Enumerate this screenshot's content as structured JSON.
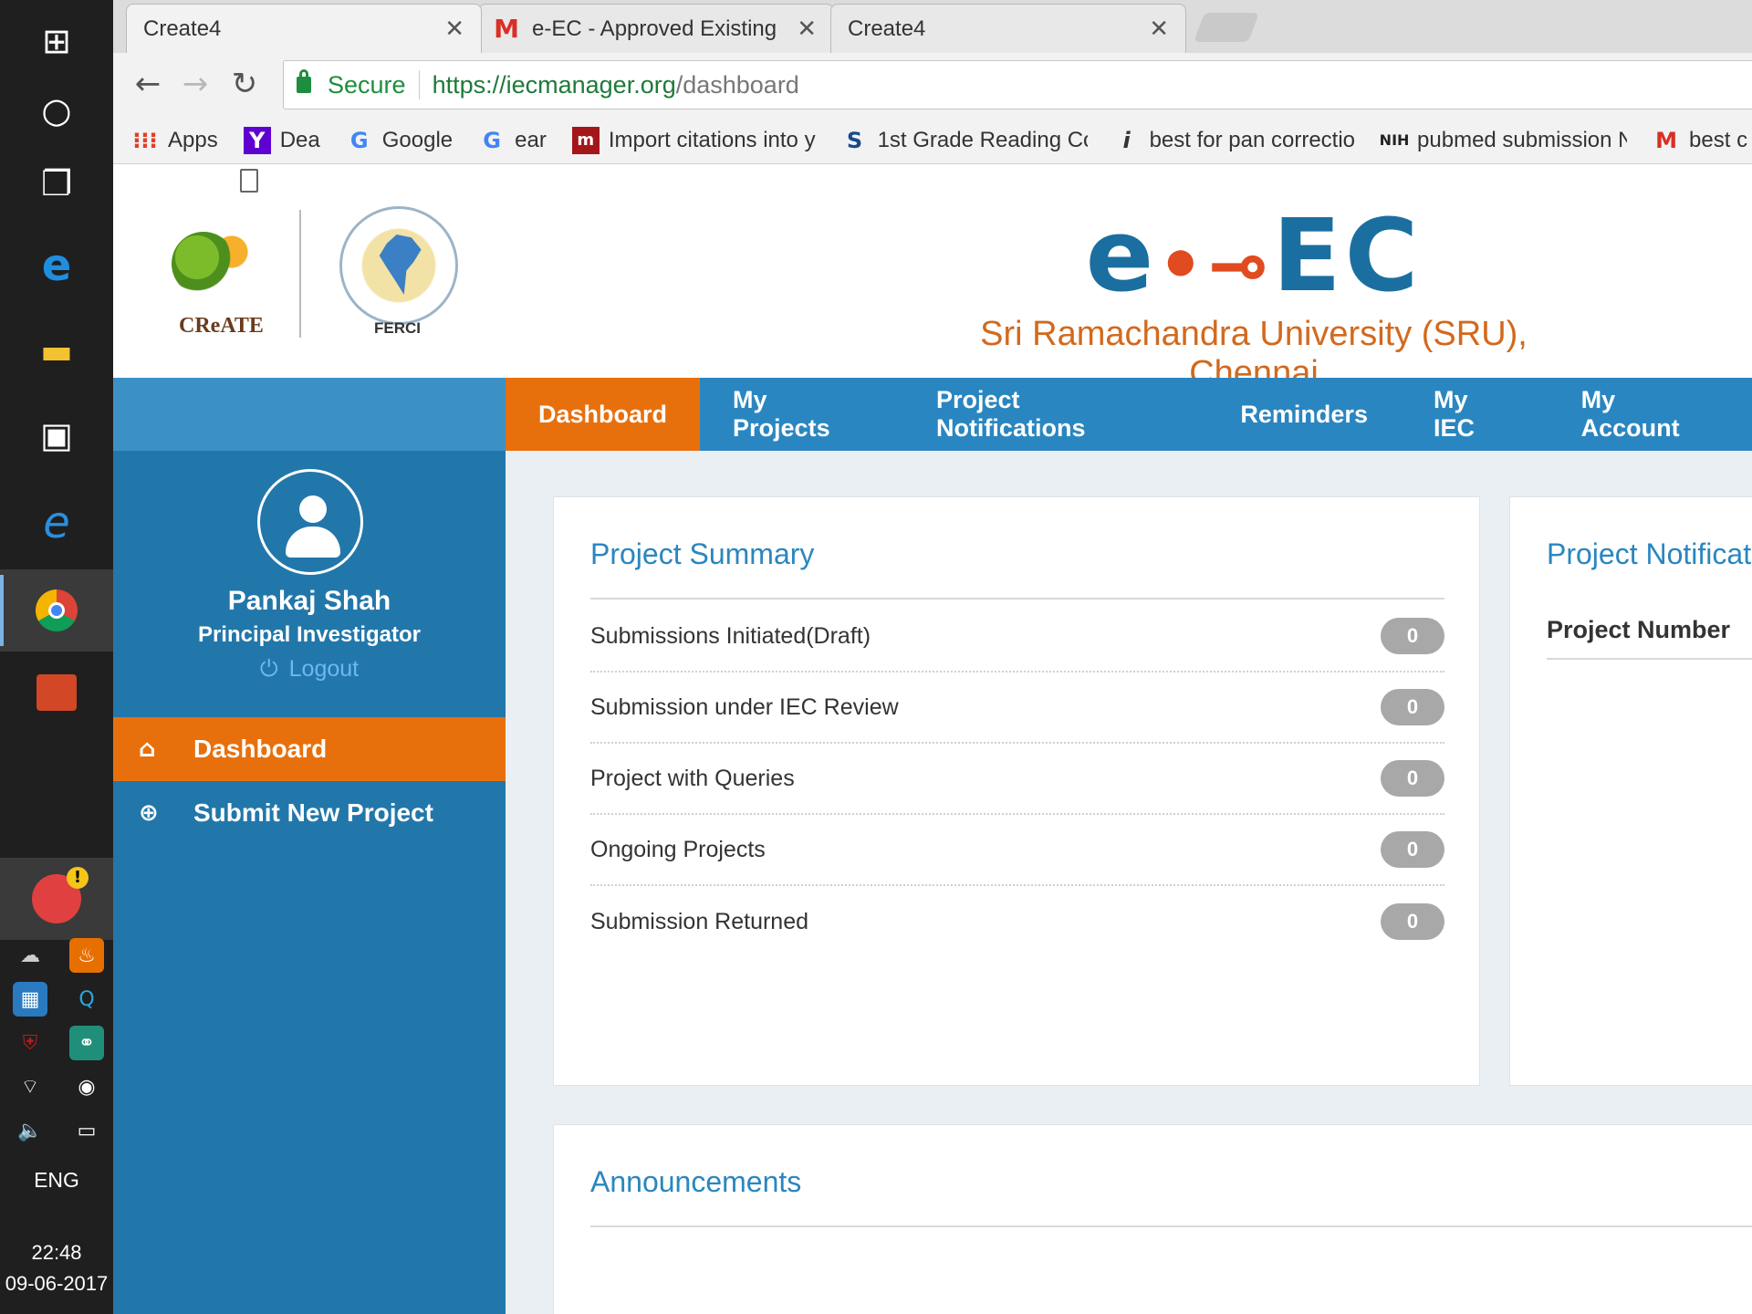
{
  "taskbar": {
    "icons": [
      "start-windows",
      "cortana",
      "task-view",
      "edge",
      "file-explorer",
      "store",
      "internet-explorer",
      "chrome",
      "powerpoint"
    ],
    "lang": "ENG",
    "time": "22:48",
    "date": "09-06-2017"
  },
  "browser": {
    "tabs": [
      {
        "title": "Create4",
        "active": true
      },
      {
        "title": "e-EC - Approved Existing",
        "active": false
      },
      {
        "title": "Create4",
        "active": false
      }
    ],
    "secure_label": "Secure",
    "url_scheme_host": "https://iecmanager.org",
    "url_path": "/dashboard",
    "bookmarks": [
      {
        "label": "Apps",
        "icon": "apps-grid-icon",
        "color": "#e0402a"
      },
      {
        "label": "Dea",
        "icon": "yahoo-icon",
        "color": "#5f01d1"
      },
      {
        "label": "Google",
        "icon": "google-icon",
        "color": "#4285f4"
      },
      {
        "label": "ear",
        "icon": "google-icon",
        "color": "#4285f4"
      },
      {
        "label": "Import citations into y",
        "icon": "mendeley-icon",
        "color": "#a4161a"
      },
      {
        "label": "1st Grade Reading Co",
        "icon": "s-logo-icon",
        "color": "#1a4a8a"
      },
      {
        "label": "best for pan correctio",
        "icon": "i-icon",
        "color": "#333333"
      },
      {
        "label": "pubmed submission N",
        "icon": "nih-icon",
        "color": "#222222"
      },
      {
        "label": "best c",
        "icon": "gmail-icon",
        "color": "#d93025"
      }
    ]
  },
  "header": {
    "create_label": "CReATE",
    "ferci_label": "FERCI",
    "brand_e": "e",
    "brand_ec": "EC",
    "institution": "Sri Ramachandra University (SRU), Chennai"
  },
  "topnav": {
    "items": [
      "Dashboard",
      "My Projects",
      "Project Notifications",
      "Reminders",
      "My IEC",
      "My Account"
    ],
    "active": "Dashboard"
  },
  "sidebar": {
    "user_name": "Pankaj Shah",
    "user_role": "Principal Investigator",
    "logout_label": "Logout",
    "items": [
      {
        "label": "Dashboard",
        "icon": "inbox-icon"
      },
      {
        "label": "Submit New Project",
        "icon": "plus-circle-icon"
      }
    ]
  },
  "project_summary": {
    "title": "Project Summary",
    "rows": [
      {
        "label": "Submissions Initiated(Draft)",
        "count": "0"
      },
      {
        "label": "Submission under IEC Review",
        "count": "0"
      },
      {
        "label": "Project with Queries",
        "count": "0"
      },
      {
        "label": "Ongoing Projects",
        "count": "0"
      },
      {
        "label": "Submission Returned",
        "count": "0"
      }
    ]
  },
  "project_notifications": {
    "title": "Project Notificatio",
    "column_header": "Project Number"
  },
  "announcements": {
    "title": "Announcements"
  },
  "colors": {
    "nav_blue": "#2a86c0",
    "sidebar_blue": "#2277aa",
    "active_orange": "#e8700c",
    "badge_gray": "#a8a8a8"
  }
}
